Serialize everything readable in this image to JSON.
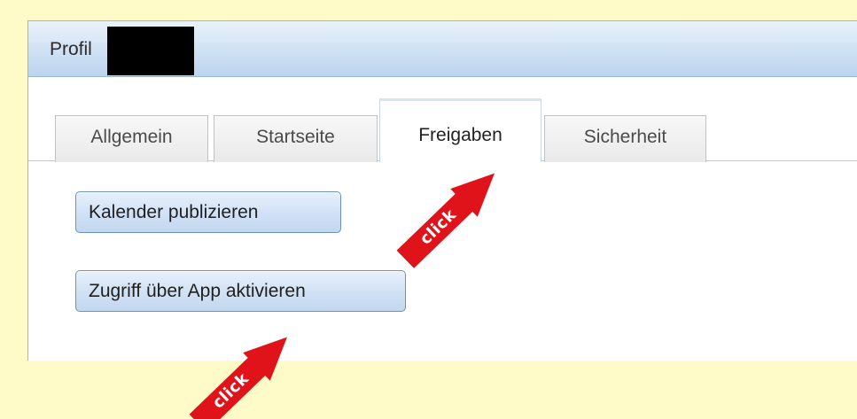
{
  "dialog": {
    "title": "Profil"
  },
  "tabs": [
    {
      "label": "Allgemein",
      "active": false
    },
    {
      "label": "Startseite",
      "active": false
    },
    {
      "label": "Freigaben",
      "active": true
    },
    {
      "label": "Sicherheit",
      "active": false
    }
  ],
  "buttons": {
    "publish_calendar": "Kalender publizieren",
    "enable_app_access": "Zugriff über App aktivieren"
  },
  "annotations": {
    "tab_arrow_label": "click",
    "button_arrow_label": "click",
    "arrow_color": "#e0121a"
  },
  "colors": {
    "background": "#fffbc8",
    "title_bar": "#cfe1f4",
    "button_border": "#6f92bd"
  }
}
